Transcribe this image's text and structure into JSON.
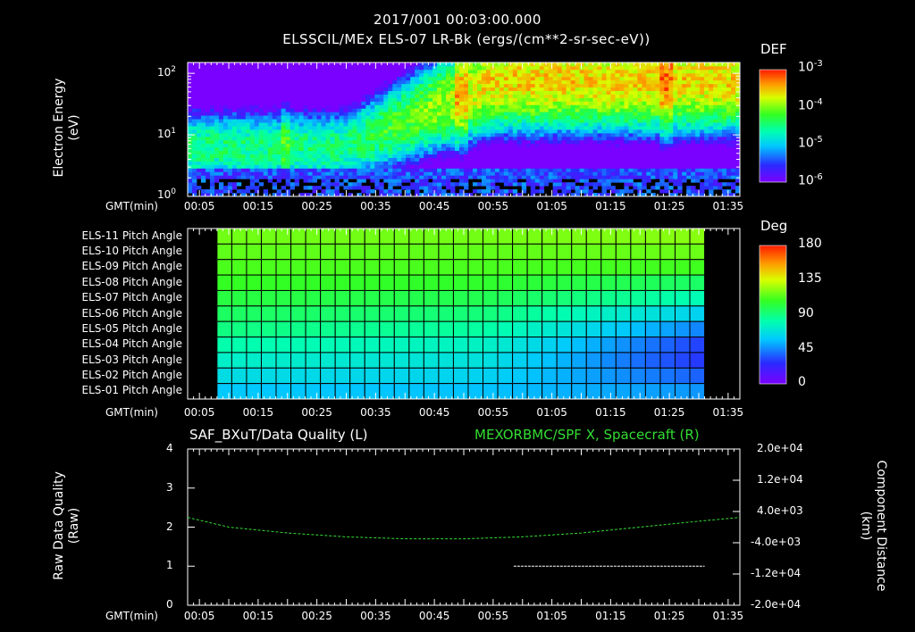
{
  "header": {
    "line1": "2017/001 00:03:00.000",
    "line2": "ELSSCIL/MEx ELS-07 LR-Bk  (ergs/(cm**2-sr-sec-eV))"
  },
  "time_axis": {
    "label": "GMT(min)",
    "ticks": [
      "00:05",
      "00:15",
      "00:25",
      "00:35",
      "00:45",
      "00:55",
      "01:05",
      "01:15",
      "01:25",
      "01:35"
    ]
  },
  "panel1": {
    "ylabel_line1": "Electron Energy",
    "ylabel_line2": "(eV)",
    "yticks": [
      {
        "base": "10",
        "exp": "2"
      },
      {
        "base": "10",
        "exp": "1"
      },
      {
        "base": "10",
        "exp": "0"
      }
    ],
    "colorbar_title": "DEF",
    "colorbar_ticks": [
      {
        "base": "10",
        "exp": "-3"
      },
      {
        "base": "10",
        "exp": "-4"
      },
      {
        "base": "10",
        "exp": "-5"
      },
      {
        "base": "10",
        "exp": "-6"
      }
    ]
  },
  "panel2": {
    "row_labels": [
      "ELS-11 Pitch Angle",
      "ELS-10 Pitch Angle",
      "ELS-09 Pitch Angle",
      "ELS-08 Pitch Angle",
      "ELS-07 Pitch Angle",
      "ELS-06 Pitch Angle",
      "ELS-05 Pitch Angle",
      "ELS-04 Pitch Angle",
      "ELS-03 Pitch Angle",
      "ELS-02 Pitch Angle",
      "ELS-01 Pitch Angle"
    ],
    "colorbar_title": "Deg",
    "colorbar_ticks": [
      "180",
      "135",
      "90",
      "45",
      "0"
    ]
  },
  "panel3": {
    "left_title": "SAF_BXuT/Data Quality (L)",
    "right_title": "MEXORBMC/SPF X, Spacecraft (R)",
    "right_title_color": "#33dd33",
    "ylabel_left_line1": "Raw Data Quality",
    "ylabel_left_line2": "(Raw)",
    "ylabel_right_line1": "Component Distance",
    "ylabel_right_line2": "(km)",
    "yticks_left": [
      "4",
      "3",
      "2",
      "1",
      "0"
    ],
    "yticks_right": [
      "2.0e+04",
      "1.2e+04",
      "4.0e+03",
      "-4.0e+03",
      "-1.2e+04",
      "-2.0e+04"
    ]
  },
  "chart_data": [
    {
      "type": "heatmap",
      "title": "ELSSCIL/MEx ELS-07 LR-Bk  (ergs/(cm**2-sr-sec-eV))",
      "xlabel": "GMT(min)",
      "ylabel": "Electron Energy (eV)",
      "x_range_min": [
        3,
        97
      ],
      "y_scale": "log",
      "y_range_ev": [
        1,
        150
      ],
      "colorbar": {
        "label": "DEF",
        "scale": "log",
        "range": [
          1e-06,
          0.001
        ]
      },
      "features": [
        {
          "description_time_min": [
            3,
            30
          ],
          "dominant_energy_ev": [
            5,
            30
          ],
          "level": 1e-05
        },
        {
          "description_time_min": [
            55,
            97
          ],
          "dominant_energy_ev": [
            15,
            150
          ],
          "level": 0.0001
        }
      ]
    },
    {
      "type": "heatmap",
      "title": "",
      "xlabel": "GMT(min)",
      "ylabel": "",
      "x_range_min": [
        3,
        97
      ],
      "data_x_min": [
        8,
        91
      ],
      "rows": [
        "ELS-11",
        "ELS-10",
        "ELS-09",
        "ELS-08",
        "ELS-07",
        "ELS-06",
        "ELS-05",
        "ELS-04",
        "ELS-03",
        "ELS-02",
        "ELS-01"
      ],
      "colorbar": {
        "label": "Deg",
        "range": [
          0,
          180
        ]
      },
      "values_deg_start": [
        118,
        115,
        112,
        108,
        102,
        96,
        90,
        82,
        74,
        66,
        58
      ],
      "values_deg_end": [
        122,
        117,
        110,
        95,
        80,
        62,
        45,
        32,
        30,
        38,
        48
      ]
    },
    {
      "type": "line",
      "title": "",
      "xlabel": "GMT(min)",
      "x_range_min": [
        3,
        97
      ],
      "ylim_left": [
        0,
        4
      ],
      "ylim_right": [
        -20000,
        20000
      ],
      "series": [
        {
          "name": "SAF_BXuT/Data Quality",
          "axis": "left",
          "color": "#ffffff",
          "x": [
            8,
            58.5,
            58.5,
            91
          ],
          "y": [
            0,
            0,
            1,
            1
          ]
        },
        {
          "name": "MEXORBMC/SPF X, Spacecraft",
          "axis": "right",
          "color": "#33dd33",
          "x": [
            3,
            10,
            20,
            30,
            40,
            50,
            60,
            70,
            80,
            90,
            97
          ],
          "y": [
            2500,
            0,
            -1500,
            -2500,
            -3000,
            -3000,
            -2500,
            -1500,
            0,
            1500,
            2500
          ]
        }
      ]
    }
  ]
}
